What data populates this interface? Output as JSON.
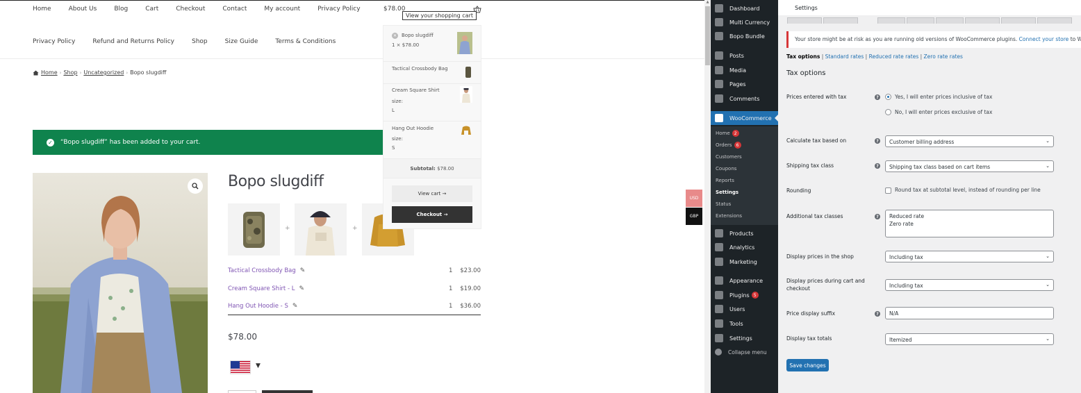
{
  "store": {
    "nav_primary": [
      "Home",
      "About Us",
      "Blog",
      "Cart",
      "Checkout",
      "Contact",
      "My account",
      "Privacy Policy"
    ],
    "nav_secondary": [
      "Privacy Policy",
      "Refund and Returns Policy",
      "Shop",
      "Size Guide",
      "Terms & Conditions"
    ],
    "cart_amount": "$78.00",
    "cart_tooltip": "View your shopping cart",
    "breadcrumb": {
      "home": "Home",
      "shop": "Shop",
      "category": "Uncategorized",
      "current": "Bopo slugdiff"
    },
    "notice": "“Bopo slugdiff” has been added to your cart.",
    "product": {
      "title": "Bopo slugdiff",
      "bundle_items": [
        {
          "name": "Tactical Crossbody Bag",
          "qty": "1",
          "price": "$23.00"
        },
        {
          "name": "Cream Square Shirt - L",
          "qty": "1",
          "price": "$19.00"
        },
        {
          "name": "Hang Out Hoodie - S",
          "qty": "1",
          "price": "$36.00"
        }
      ],
      "total": "$78.00",
      "flag_caret": "▼"
    },
    "minicart": {
      "item1_name": "Bopo slugdiff",
      "item1_qty_price": "1 × $78.00",
      "item2_name": "Tactical Crossbody Bag",
      "item3_name": "Cream Square Shirt",
      "item3_attr": "size:",
      "item3_val": "L",
      "item4_name": "Hang Out Hoodie",
      "item4_attr": "size:",
      "item4_val": "S",
      "subtotal_label": "Subtotal:",
      "subtotal_value": "$78.00",
      "view_cart": "View cart →",
      "checkout": "Checkout →"
    },
    "currency": {
      "usd": "USD",
      "gbp": "GBP"
    }
  },
  "admin": {
    "menu_top": [
      "Dashboard",
      "Multi Currency",
      "Bopo Bundle"
    ],
    "menu_mid": [
      "Posts",
      "Media",
      "Pages",
      "Comments"
    ],
    "woocommerce": "WooCommerce",
    "woo_sub": {
      "home": "Home",
      "home_badge": "2",
      "orders": "Orders",
      "orders_badge": "6",
      "customers": "Customers",
      "coupons": "Coupons",
      "reports": "Reports",
      "settings": "Settings",
      "status": "Status",
      "extensions": "Extensions"
    },
    "menu_bottom": [
      "Products",
      "Analytics",
      "Marketing"
    ],
    "menu_bottom2": {
      "appearance": "Appearance",
      "plugins": "Plugins",
      "plugins_badge": "5",
      "users": "Users",
      "tools": "Tools",
      "settings": "Settings"
    },
    "collapse": "Collapse menu",
    "page_title": "Settings",
    "notice_text": "Your store might be at risk as you are running old versions of WooCommerce plugins.",
    "notice_link": "Connect your store",
    "notice_tail": "to WooCommerce",
    "subsub": {
      "tax_options": "Tax options",
      "standard": "Standard rates",
      "reduced": "Reduced rate rates",
      "zero": "Zero rate rates"
    },
    "section_title": "Tax options",
    "fields": {
      "prices_entered": "Prices entered with tax",
      "radio_yes": "Yes, I will enter prices inclusive of tax",
      "radio_no": "No, I will enter prices exclusive of tax",
      "calc_based": "Calculate tax based on",
      "calc_based_val": "Customer billing address",
      "shipping_class": "Shipping tax class",
      "shipping_class_val": "Shipping tax class based on cart items",
      "rounding": "Rounding",
      "rounding_cb": "Round tax at subtotal level, instead of rounding per line",
      "additional": "Additional tax classes",
      "additional_val": "Reduced rate\nZero rate",
      "display_shop": "Display prices in the shop",
      "display_shop_val": "Including tax",
      "display_cart": "Display prices during cart and checkout",
      "display_cart_val": "Including tax",
      "suffix": "Price display suffix",
      "suffix_val": "N/A",
      "tax_totals": "Display tax totals",
      "tax_totals_val": "Itemized"
    },
    "save": "Save changes"
  }
}
